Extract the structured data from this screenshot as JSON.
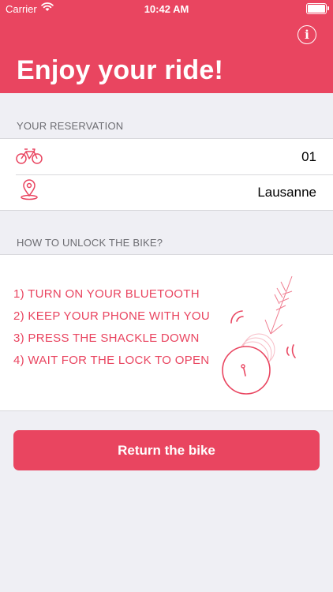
{
  "status_bar": {
    "carrier": "Carrier",
    "time": "10:42 AM"
  },
  "header": {
    "title": "Enjoy your ride!",
    "info_icon": "info-icon"
  },
  "reservation": {
    "section_label": "YOUR RESERVATION",
    "rows": [
      {
        "icon": "bike-icon",
        "value": "01"
      },
      {
        "icon": "location-pin-icon",
        "value": "Lausanne"
      }
    ]
  },
  "unlock": {
    "section_label": "HOW TO UNLOCK THE BIKE?",
    "steps": [
      "1) TURN ON YOUR BLUETOOTH",
      "2) KEEP YOUR PHONE WITH YOU",
      "3) PRESS THE SHACKLE DOWN",
      "4) WAIT FOR THE LOCK TO OPEN"
    ],
    "illustration": "bike-lock-illustration"
  },
  "actions": {
    "return_label": "Return the bike"
  },
  "colors": {
    "accent": "#e94560",
    "background": "#efeff4"
  }
}
